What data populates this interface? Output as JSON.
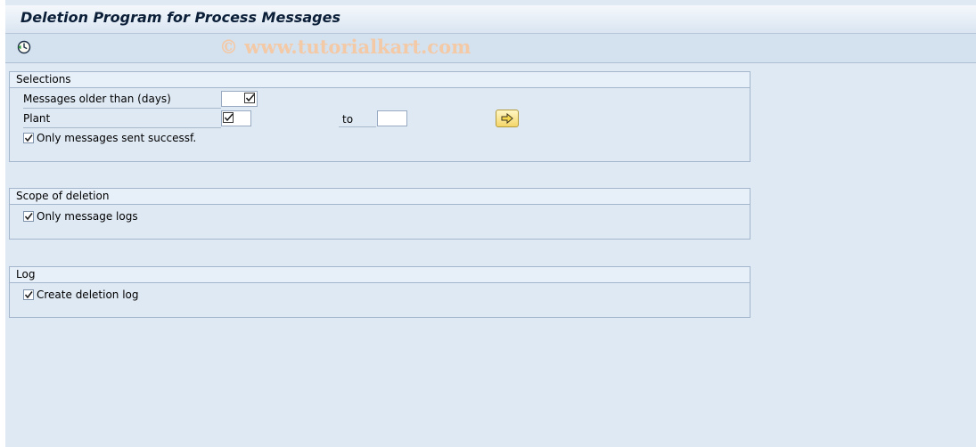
{
  "window": {
    "title": "Deletion Program for Process Messages"
  },
  "toolbar": {
    "execute_icon": "clock-execute-icon",
    "watermark": "© www.tutorialkart.com"
  },
  "selections": {
    "header": "Selections",
    "messages_older_label": "Messages older than (days)",
    "messages_older_value": "",
    "plant_label": "Plant",
    "plant_from_value": "",
    "to_label": "to",
    "plant_to_value": "",
    "multiple_selection_icon": "arrow-right-icon",
    "only_sent_label": "Only messages sent successf.",
    "only_sent_checked": true
  },
  "scope": {
    "header": "Scope of deletion",
    "only_logs_label": "Only message logs",
    "only_logs_checked": true
  },
  "log": {
    "header": "Log",
    "create_log_label": "Create deletion log",
    "create_log_checked": true
  }
}
